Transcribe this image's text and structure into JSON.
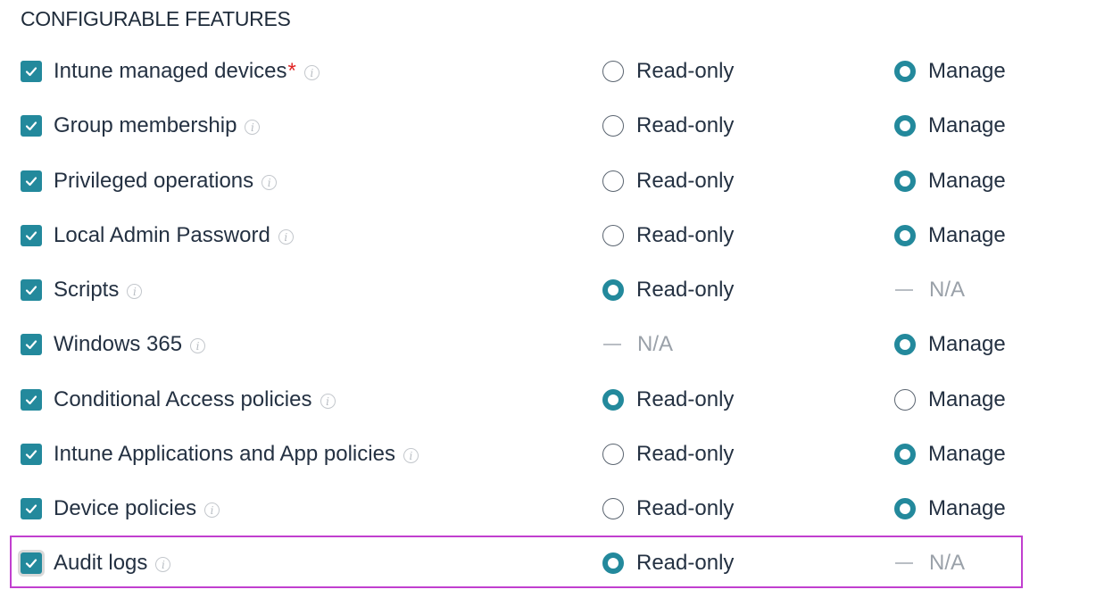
{
  "section_title": "CONFIGURABLE FEATURES",
  "required_mark": "*",
  "info_glyph": "i",
  "options": {
    "read_only": "Read-only",
    "manage": "Manage",
    "na": "N/A"
  },
  "colors": {
    "accent": "#23899c",
    "required": "#e02424",
    "highlight": "#c13fcf"
  },
  "features": [
    {
      "label": "Intune managed devices",
      "required": true,
      "checked": true,
      "read_only": "unchecked",
      "manage": "checked"
    },
    {
      "label": "Group membership",
      "required": false,
      "checked": true,
      "read_only": "unchecked",
      "manage": "checked"
    },
    {
      "label": "Privileged operations",
      "required": false,
      "checked": true,
      "read_only": "unchecked",
      "manage": "checked"
    },
    {
      "label": "Local Admin Password",
      "required": false,
      "checked": true,
      "read_only": "unchecked",
      "manage": "checked"
    },
    {
      "label": "Scripts",
      "required": false,
      "checked": true,
      "read_only": "checked",
      "manage": "na"
    },
    {
      "label": "Windows 365",
      "required": false,
      "checked": true,
      "read_only": "na",
      "manage": "checked"
    },
    {
      "label": "Conditional Access policies",
      "required": false,
      "checked": true,
      "read_only": "checked",
      "manage": "unchecked"
    },
    {
      "label": "Intune Applications and App policies",
      "required": false,
      "checked": true,
      "read_only": "unchecked",
      "manage": "checked"
    },
    {
      "label": "Device policies",
      "required": false,
      "checked": true,
      "read_only": "unchecked",
      "manage": "checked"
    },
    {
      "label": "Audit logs",
      "required": false,
      "checked": true,
      "read_only": "checked",
      "manage": "na",
      "highlighted": true
    }
  ]
}
